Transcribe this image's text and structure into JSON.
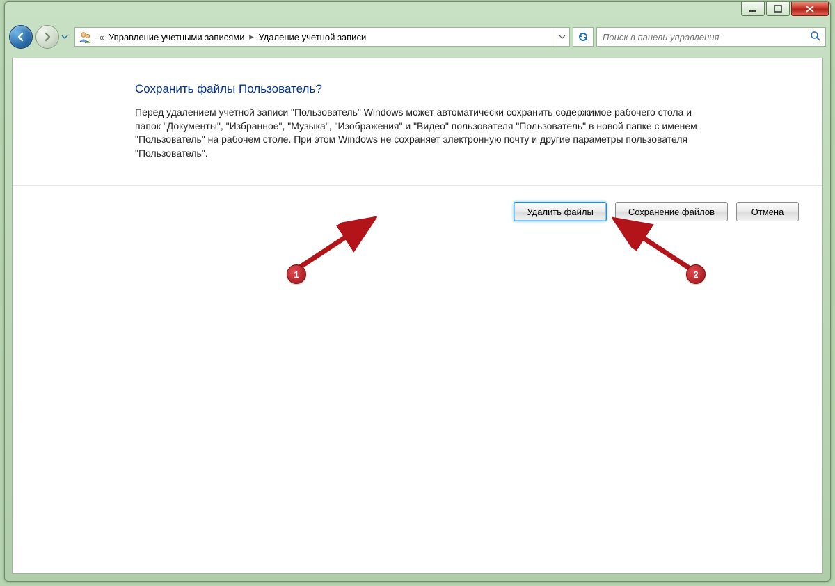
{
  "breadcrumb": {
    "item1": "Управление учетными записями",
    "item2": "Удаление учетной записи"
  },
  "search": {
    "placeholder": "Поиск в панели управления"
  },
  "page": {
    "title": "Сохранить файлы Пользователь?",
    "body": "Перед удалением учетной записи \"Пользователь\" Windows может автоматически сохранить содержимое рабочего стола и папок \"Документы\", \"Избранное\", \"Музыка\", \"Изображения\" и \"Видео\" пользователя \"Пользователь\" в новой папке с именем \"Пользователь\" на рабочем столе. При этом Windows не сохраняет электронную почту и другие параметры пользователя \"Пользователь\"."
  },
  "buttons": {
    "delete": "Удалить файлы",
    "save": "Сохранение файлов",
    "cancel": "Отмена"
  },
  "annotations": {
    "n1": "1",
    "n2": "2"
  }
}
